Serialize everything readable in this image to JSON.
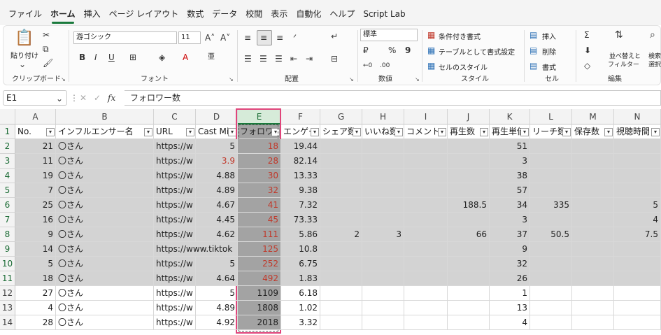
{
  "menu": {
    "tabs": [
      "ファイル",
      "ホーム",
      "挿入",
      "ページ レイアウト",
      "数式",
      "データ",
      "校閲",
      "表示",
      "自動化",
      "ヘルプ",
      "Script Lab"
    ],
    "active_tab": "ホーム"
  },
  "ribbon": {
    "clipboard": {
      "paste": "貼り付け",
      "label": "クリップボード"
    },
    "font": {
      "name": "游ゴシック",
      "size": "11",
      "label": "フォント"
    },
    "alignment": {
      "label": "配置"
    },
    "number": {
      "format": "標準",
      "percent": "%",
      "comma": "9",
      "label": "数値"
    },
    "style": {
      "conditional": "条件付き書式",
      "as_table": "テーブルとして書式設定",
      "cell_style": "セルのスタイル",
      "label": "スタイル"
    },
    "cells": {
      "insert": "挿入",
      "delete": "削除",
      "format": "書式",
      "label": "セル"
    },
    "editing": {
      "sort": "並べ替えと",
      "filter": "フィルター",
      "search": "検索",
      "select": "選択",
      "label": "編集"
    }
  },
  "formula_bar": {
    "name_box": "E1",
    "formula": "フォロワー数",
    "fx": "fx"
  },
  "grid": {
    "columns": [
      "A",
      "B",
      "C",
      "D",
      "E",
      "F",
      "G",
      "H",
      "I",
      "J",
      "K",
      "L",
      "M",
      "N"
    ],
    "selected_column": "E",
    "headers": [
      "No.",
      "インフルエンサー名",
      "URL",
      "Cast Mi",
      "フォロワ",
      "エンゲー",
      "シェア数",
      "いいね数",
      "コメント",
      "再生数",
      "再生単価",
      "リーチ数",
      "保存数",
      "視聴時間"
    ],
    "rows": [
      {
        "n": "2",
        "a": "21",
        "b": "〇さん",
        "c": "https://w",
        "d": "5",
        "e": "18",
        "f": "19.44",
        "g": "",
        "h": "",
        "i": "",
        "j": "",
        "k": "51",
        "l": "",
        "m": "",
        "nn": ""
      },
      {
        "n": "3",
        "a": "11",
        "b": "〇さん",
        "c": "https://w",
        "d": "3.9",
        "e": "28",
        "f": "82.14",
        "g": "",
        "h": "",
        "i": "",
        "j": "",
        "k": "3",
        "l": "",
        "m": "",
        "nn": ""
      },
      {
        "n": "4",
        "a": "19",
        "b": "〇さん",
        "c": "https://w",
        "d": "4.88",
        "e": "30",
        "f": "13.33",
        "g": "",
        "h": "",
        "i": "",
        "j": "",
        "k": "38",
        "l": "",
        "m": "",
        "nn": ""
      },
      {
        "n": "5",
        "a": "7",
        "b": "〇さん",
        "c": "https://w",
        "d": "4.89",
        "e": "32",
        "f": "9.38",
        "g": "",
        "h": "",
        "i": "",
        "j": "",
        "k": "57",
        "l": "",
        "m": "",
        "nn": ""
      },
      {
        "n": "6",
        "a": "25",
        "b": "〇さん",
        "c": "https://w",
        "d": "4.67",
        "e": "41",
        "f": "7.32",
        "g": "",
        "h": "",
        "i": "",
        "j": "188.5",
        "k": "34",
        "l": "335",
        "m": "",
        "nn": "5"
      },
      {
        "n": "7",
        "a": "16",
        "b": "〇さん",
        "c": "https://w",
        "d": "4.45",
        "e": "45",
        "f": "73.33",
        "g": "",
        "h": "",
        "i": "",
        "j": "",
        "k": "3",
        "l": "",
        "m": "",
        "nn": "4"
      },
      {
        "n": "8",
        "a": "9",
        "b": "〇さん",
        "c": "https://w",
        "d": "4.62",
        "e": "111",
        "f": "5.86",
        "g": "2",
        "h": "3",
        "i": "",
        "j": "66",
        "k": "37",
        "l": "50.5",
        "m": "",
        "nn": "7.5"
      },
      {
        "n": "9",
        "a": "14",
        "b": "〇さん",
        "c": "https://www.tiktok",
        "d": "",
        "e": "125",
        "f": "10.8",
        "g": "",
        "h": "",
        "i": "",
        "j": "",
        "k": "9",
        "l": "",
        "m": "",
        "nn": ""
      },
      {
        "n": "10",
        "a": "5",
        "b": "〇さん",
        "c": "https://w",
        "d": "5",
        "e": "252",
        "f": "6.75",
        "g": "",
        "h": "",
        "i": "",
        "j": "",
        "k": "32",
        "l": "",
        "m": "",
        "nn": ""
      },
      {
        "n": "11",
        "a": "18",
        "b": "〇さん",
        "c": "https://w",
        "d": "4.64",
        "e": "492",
        "f": "1.83",
        "g": "",
        "h": "",
        "i": "",
        "j": "",
        "k": "26",
        "l": "",
        "m": "",
        "nn": ""
      },
      {
        "n": "12",
        "a": "27",
        "b": "〇さん",
        "c": "https://w",
        "d": "5",
        "e": "1109",
        "f": "6.18",
        "g": "",
        "h": "",
        "i": "",
        "j": "",
        "k": "1",
        "l": "",
        "m": "",
        "nn": ""
      },
      {
        "n": "13",
        "a": "4",
        "b": "〇さん",
        "c": "https://w",
        "d": "4.89",
        "e": "1808",
        "f": "1.02",
        "g": "",
        "h": "",
        "i": "",
        "j": "",
        "k": "13",
        "l": "",
        "m": "",
        "nn": ""
      },
      {
        "n": "14",
        "a": "28",
        "b": "〇さん",
        "c": "https://w",
        "d": "4.92",
        "e": "2018",
        "f": "3.32",
        "g": "",
        "h": "",
        "i": "",
        "j": "",
        "k": "4",
        "l": "",
        "m": "",
        "nn": ""
      }
    ]
  },
  "colors": {
    "accent": "#1a7a3c",
    "highlight_border": "#e0447a",
    "red_text": "#c0392b"
  }
}
